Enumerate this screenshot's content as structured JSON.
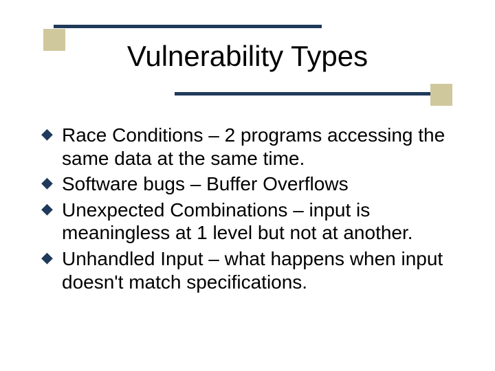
{
  "title": "Vulnerability Types",
  "bullets": [
    "Race Conditions – 2 programs accessing the same data at the same time.",
    "Software bugs – Buffer Overflows",
    "Unexpected Combinations – input is meaningless at 1 level but not at another.",
    "Unhandled Input – what happens when input doesn't match specifications."
  ],
  "colors": {
    "rule": "#1f3a5a",
    "accent_square": "#d0c89d"
  }
}
